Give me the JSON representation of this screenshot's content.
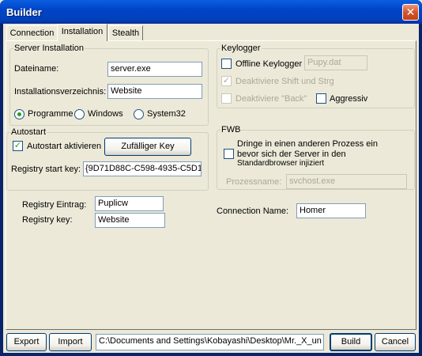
{
  "window": {
    "title": "Builder"
  },
  "tabs": [
    {
      "label": "Connection"
    },
    {
      "label": "Installation"
    },
    {
      "label": "Stealth"
    }
  ],
  "server_installation": {
    "legend": "Server Installation",
    "dateiname_label": "Dateiname:",
    "dateiname_value": "server.exe",
    "verzeichnis_label": "Installationsverzeichnis:",
    "verzeichnis_value": "Website",
    "radio_options": [
      {
        "label": "Programme",
        "selected": true
      },
      {
        "label": "Windows",
        "selected": false
      },
      {
        "label": "System32",
        "selected": false
      }
    ]
  },
  "autostart": {
    "legend": "Autostart",
    "checkbox_label": "Autostart aktivieren",
    "checkbox_checked": true,
    "random_key_button": "Zufälliger Key",
    "registry_start_key_label": "Registry start key:",
    "registry_start_key_value": "{9D71D88C-C598-4935-C5D1"
  },
  "keylogger": {
    "legend": "Keylogger",
    "offline_label": "Offline Keylogger",
    "offline_checked": false,
    "offline_file": "Pupy.dat",
    "shift_label": "Deaktiviere Shift und Strg",
    "shift_checked": true,
    "back_label": "Deaktiviere \"Back\"",
    "back_checked": false,
    "aggressiv_label": "Aggressiv",
    "aggressiv_checked": false
  },
  "fwb": {
    "legend": "FWB",
    "inject_label_lines": [
      "Dringe in einen anderen Prozess ein",
      "bevor sich der Server in den",
      "Standardbrowser injiziert"
    ],
    "inject_checked": false,
    "prozessname_label": "Prozessname:",
    "prozessname_value": "svchost.exe"
  },
  "registry": {
    "eintrag_label": "Registry Eintrag:",
    "eintrag_value": "Puplicw",
    "key_label": "Registry key:",
    "key_value": "Website"
  },
  "connection": {
    "name_label": "Connection Name:",
    "name_value": "Homer"
  },
  "footer": {
    "export_button": "Export",
    "import_button": "Import",
    "path_value": "C:\\Documents and Settings\\Kobayashi\\Desktop\\Mr._X_un",
    "build_button": "Build",
    "cancel_button": "Cancel"
  },
  "colors": {
    "titlebar": "#0044C8",
    "window_bg": "#ECE9D8",
    "check_green": "#21A121",
    "disabled_text": "#ACA899"
  }
}
